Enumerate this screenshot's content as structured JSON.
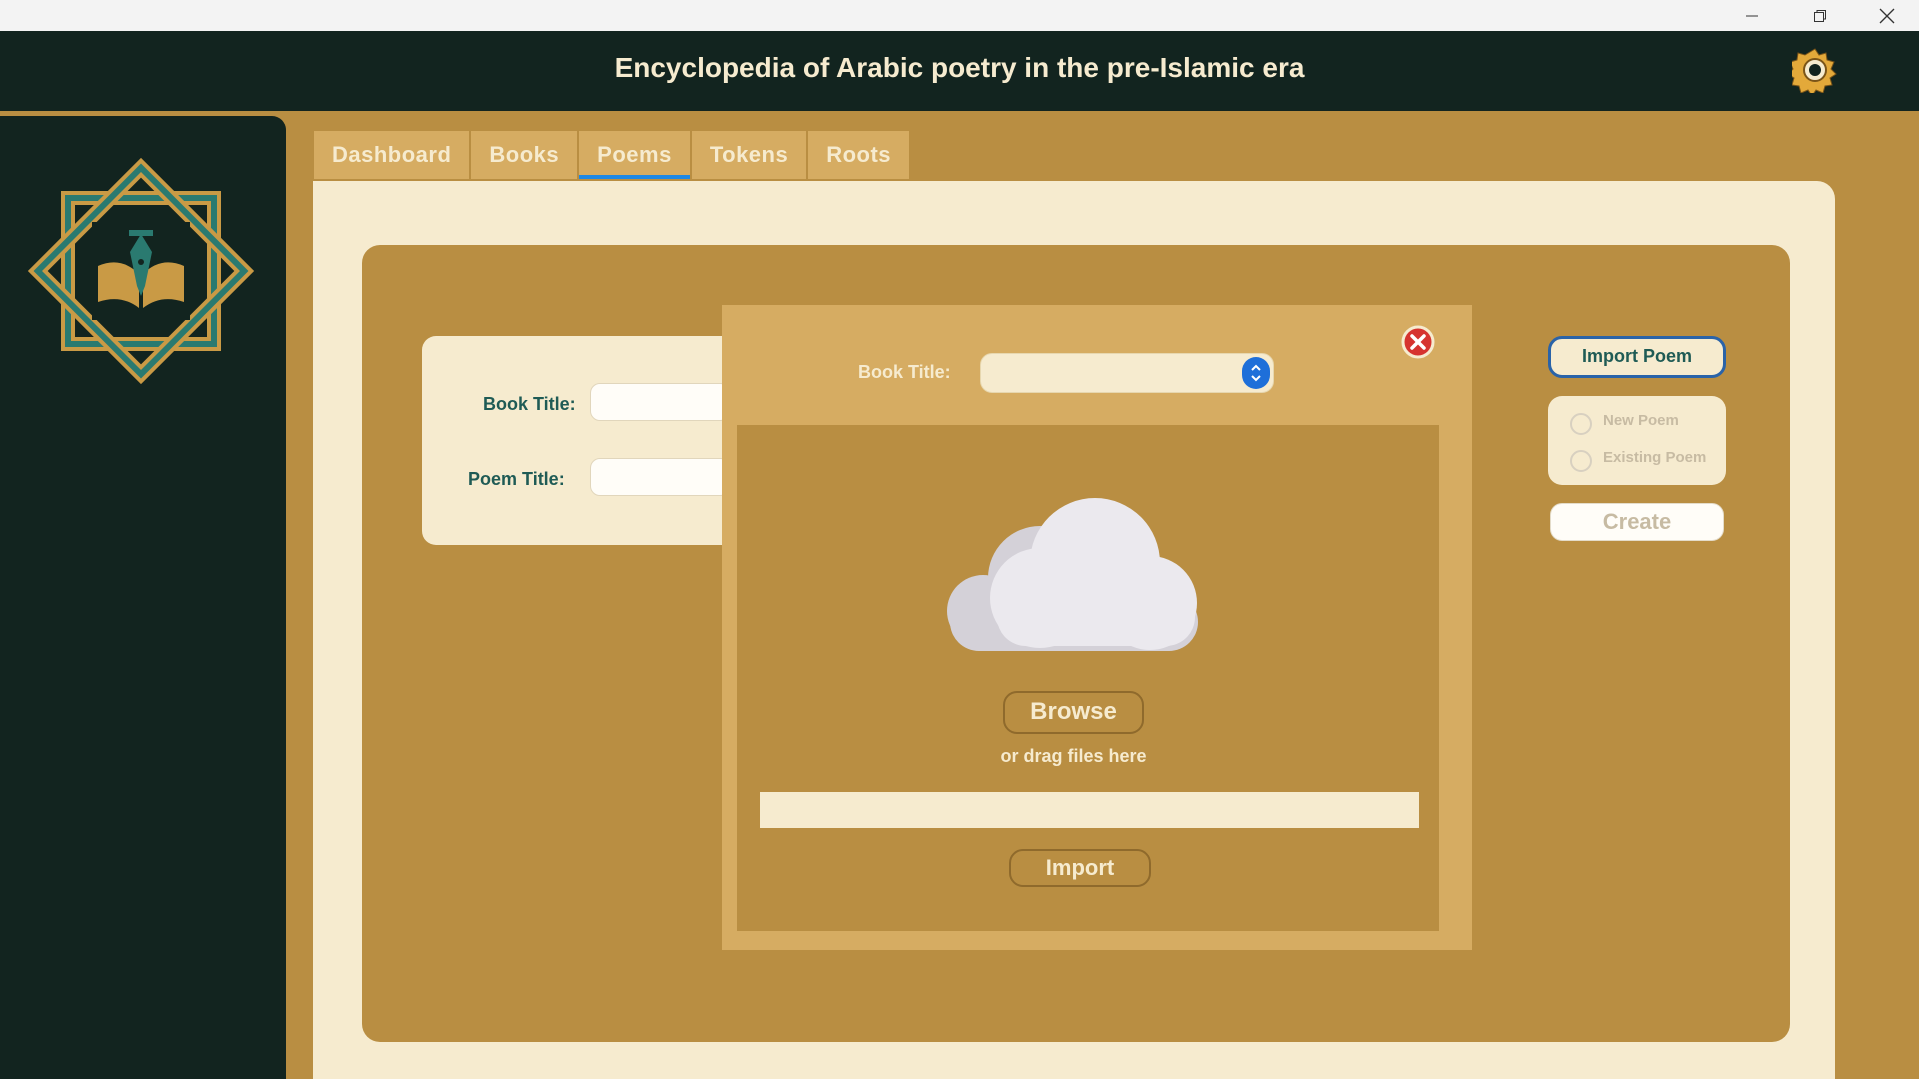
{
  "window": {
    "minimize_icon": "minimize-icon",
    "restore_icon": "restore-icon",
    "close_icon": "close-icon"
  },
  "header": {
    "title": "Encyclopedia of Arabic poetry in the pre-Islamic era",
    "settings_icon": "gear-icon"
  },
  "tabs": [
    {
      "label": "Dashboard",
      "active": false
    },
    {
      "label": "Books",
      "active": false
    },
    {
      "label": "Poems",
      "active": true
    },
    {
      "label": "Tokens",
      "active": false
    },
    {
      "label": "Roots",
      "active": false
    }
  ],
  "form": {
    "book_title_label": "Book Title:",
    "book_title_value": "",
    "poem_title_label": "Poem Title:",
    "poem_title_value": ""
  },
  "import_dialog": {
    "book_title_label": "Book Title:",
    "book_title_selected": "",
    "browse_label": "Browse",
    "drag_text": "or drag files here",
    "file_path": "",
    "import_label": "Import",
    "close_icon": "close-circle-icon",
    "upload_icon": "cloud-icon"
  },
  "actions": {
    "import_poem_label": "Import Poem",
    "new_poem_label": "New Poem",
    "existing_poem_label": "Existing Poem",
    "create_label": "Create"
  },
  "colors": {
    "header_bg": "#12241f",
    "accent_gold": "#b98e42",
    "light_gold": "#d6ac62",
    "cream": "#f6ebcf",
    "teal": "#1f5b55",
    "active_tab_underline": "#1e88e5"
  }
}
